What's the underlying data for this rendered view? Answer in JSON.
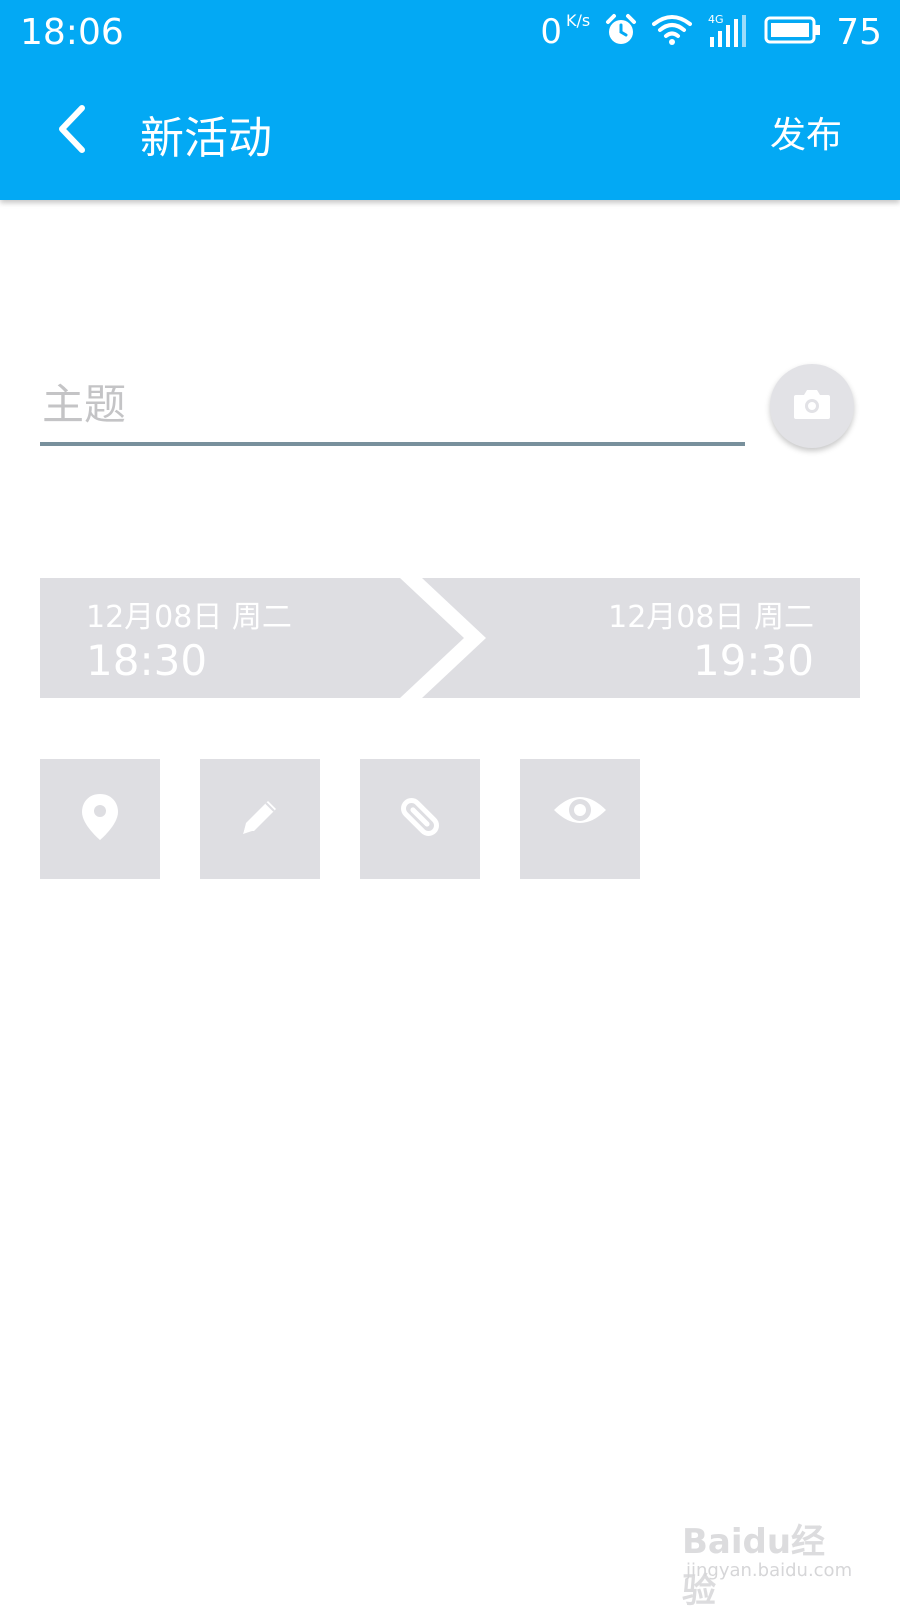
{
  "status_bar": {
    "time": "18:06",
    "net_speed": "0",
    "net_speed_unit": "K/s",
    "network_type": "4G",
    "battery": "75"
  },
  "app_bar": {
    "title": "新活动",
    "publish_label": "发布"
  },
  "form": {
    "subject_placeholder": "主题",
    "subject_value": ""
  },
  "time_range": {
    "start_date": "12月08日 周二",
    "start_time": "18:30",
    "end_date": "12月08日 周二",
    "end_time": "19:30"
  },
  "tools": [
    {
      "name": "location",
      "icon": "location-pin-icon"
    },
    {
      "name": "note",
      "icon": "pencil-icon"
    },
    {
      "name": "attachment",
      "icon": "paperclip-icon"
    },
    {
      "name": "visibility",
      "icon": "eye-icon"
    }
  ],
  "watermark": {
    "brand": "Baidu经验",
    "url": "jingyan.baidu.com"
  },
  "colors": {
    "primary": "#03A9F4",
    "tile": "#DEDEE2",
    "underline": "#78909C"
  }
}
